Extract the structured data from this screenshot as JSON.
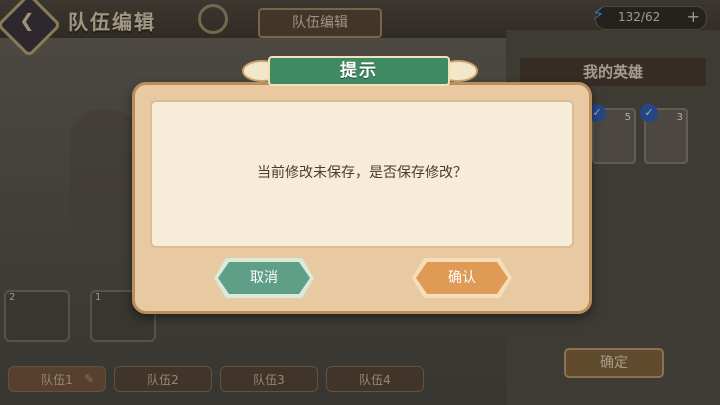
{
  "header": {
    "title": "队伍编辑",
    "center_tab": "队伍编辑",
    "energy": "132/62",
    "energy_plus": "+"
  },
  "heroes_panel": {
    "title": "我的英雄",
    "cards": [
      {
        "level": "5"
      },
      {
        "level": "3"
      }
    ],
    "confirm_label": "确定"
  },
  "slots": [
    {
      "num": "2"
    },
    {
      "num": "1"
    }
  ],
  "team_tabs": [
    "队伍1",
    "队伍2",
    "队伍3",
    "队伍4"
  ],
  "dialog": {
    "title": "提示",
    "message": "当前修改未保存，是否保存修改？",
    "cancel_label": "取消",
    "confirm_label": "确认"
  },
  "colors": {
    "dialog_bg": "#f6ecd8",
    "ribbon": "#3f8a63",
    "cancel": "#5f9f87",
    "confirm": "#df9b55"
  }
}
